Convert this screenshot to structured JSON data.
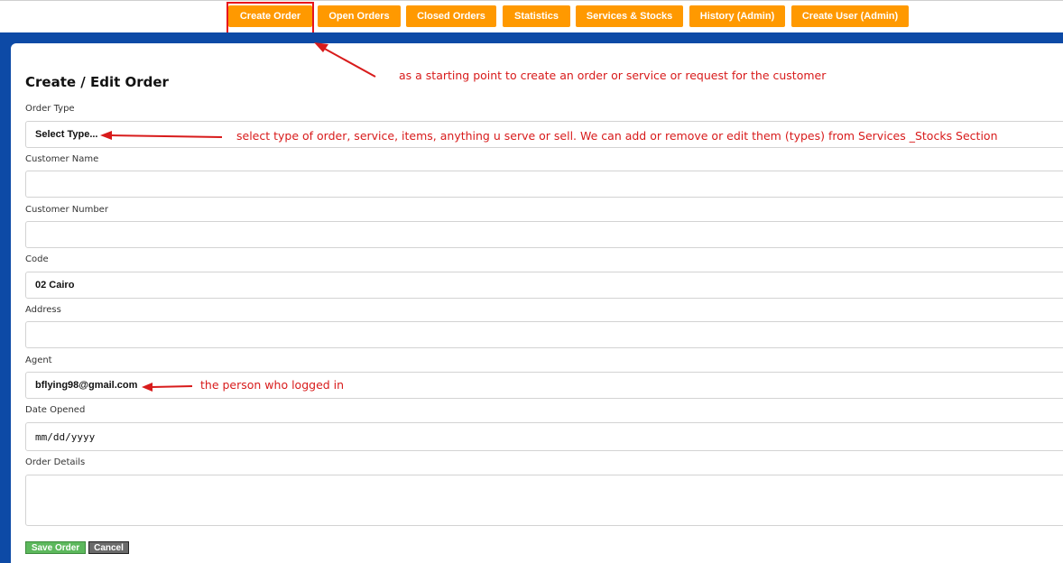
{
  "nav": {
    "items": [
      {
        "label": "Create Order"
      },
      {
        "label": "Open Orders"
      },
      {
        "label": "Closed Orders"
      },
      {
        "label": "Statistics"
      },
      {
        "label": "Services & Stocks"
      },
      {
        "label": "History (Admin)"
      },
      {
        "label": "Create User (Admin)"
      }
    ]
  },
  "form": {
    "title": "Create / Edit Order",
    "order_type": {
      "label": "Order Type",
      "value": "Select Type..."
    },
    "customer_name": {
      "label": "Customer Name",
      "value": ""
    },
    "customer_number": {
      "label": "Customer Number",
      "value": ""
    },
    "code": {
      "label": "Code",
      "value": "02 Cairo"
    },
    "address": {
      "label": "Address",
      "value": ""
    },
    "agent": {
      "label": "Agent",
      "value": "bflying98@gmail.com"
    },
    "date_opened": {
      "label": "Date Opened",
      "placeholder": "mm/dd/yyyy"
    },
    "order_details": {
      "label": "Order Details",
      "value": ""
    },
    "save_label": "Save Order",
    "cancel_label": "Cancel"
  },
  "annotations": {
    "create_order": "as a starting point to create an order or service or request for the customer",
    "order_type": "select type of order, service, items, anything u serve or sell. We can add or remove or edit them (types) from Services _Stocks Section",
    "agent": "the person who logged in"
  },
  "colors": {
    "nav_button": "#ff9900",
    "band": "#0d4aa6",
    "annotation": "#d81b1b",
    "save": "#5cb85c",
    "cancel": "#6a6a6a"
  }
}
